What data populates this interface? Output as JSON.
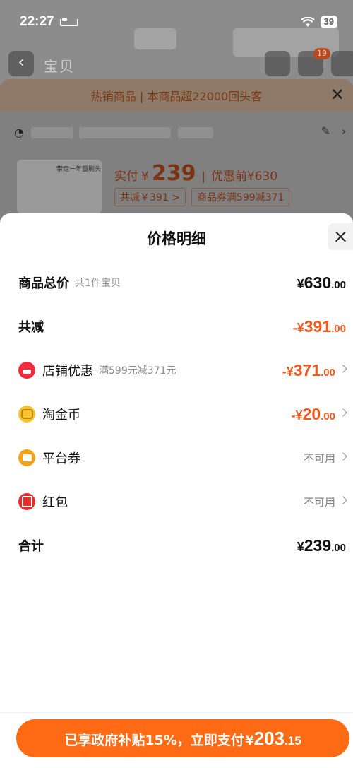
{
  "status_bar": {
    "time": "22:27",
    "battery": "39"
  },
  "background": {
    "nav_title": "宝贝",
    "cart_badge": "19",
    "hot_bar_text": "热销商品 | 本商品超22000回头客",
    "product_thumb_text": "带走一年量刷头",
    "price": {
      "label": "实付",
      "currency": "¥",
      "amount": "239",
      "before_label": "优惠前",
      "before_amount": "¥630"
    },
    "chips": [
      "共减￥391 >",
      "商品券满599减371"
    ]
  },
  "sheet": {
    "title": "价格明细",
    "rows": [
      {
        "label": "商品总价",
        "sub": "共1件宝贝",
        "currency": "¥",
        "int": "630",
        "dec": ".00",
        "tone": "black"
      },
      {
        "label": "共减",
        "sub": "",
        "currency": "-¥",
        "int": "391",
        "dec": ".00",
        "tone": "orange"
      },
      {
        "label": "店铺优惠",
        "sub": "满599元减371元",
        "currency": "-¥",
        "int": "371",
        "dec": ".00",
        "tone": "orange",
        "icon": "shop-icon"
      },
      {
        "label": "淘金币",
        "sub": "",
        "currency": "-¥",
        "int": "20",
        "dec": ".00",
        "tone": "orange",
        "icon": "coin-icon"
      },
      {
        "label": "平台券",
        "sub": "",
        "status": "不可用",
        "icon": "coupon-icon"
      },
      {
        "label": "红包",
        "sub": "",
        "status": "不可用",
        "icon": "red-packet-icon"
      },
      {
        "label": "合计",
        "sub": "",
        "currency": "¥",
        "int": "239",
        "dec": ".00",
        "tone": "black"
      }
    ]
  },
  "pay_button": {
    "text": "已享政府补贴15%，立即支付",
    "currency": "¥",
    "int": "203",
    "dec": ".15"
  },
  "colors": {
    "accent": "#ff6a14",
    "discount": "#ef5a1e",
    "overlay": "#7a7a7a"
  }
}
